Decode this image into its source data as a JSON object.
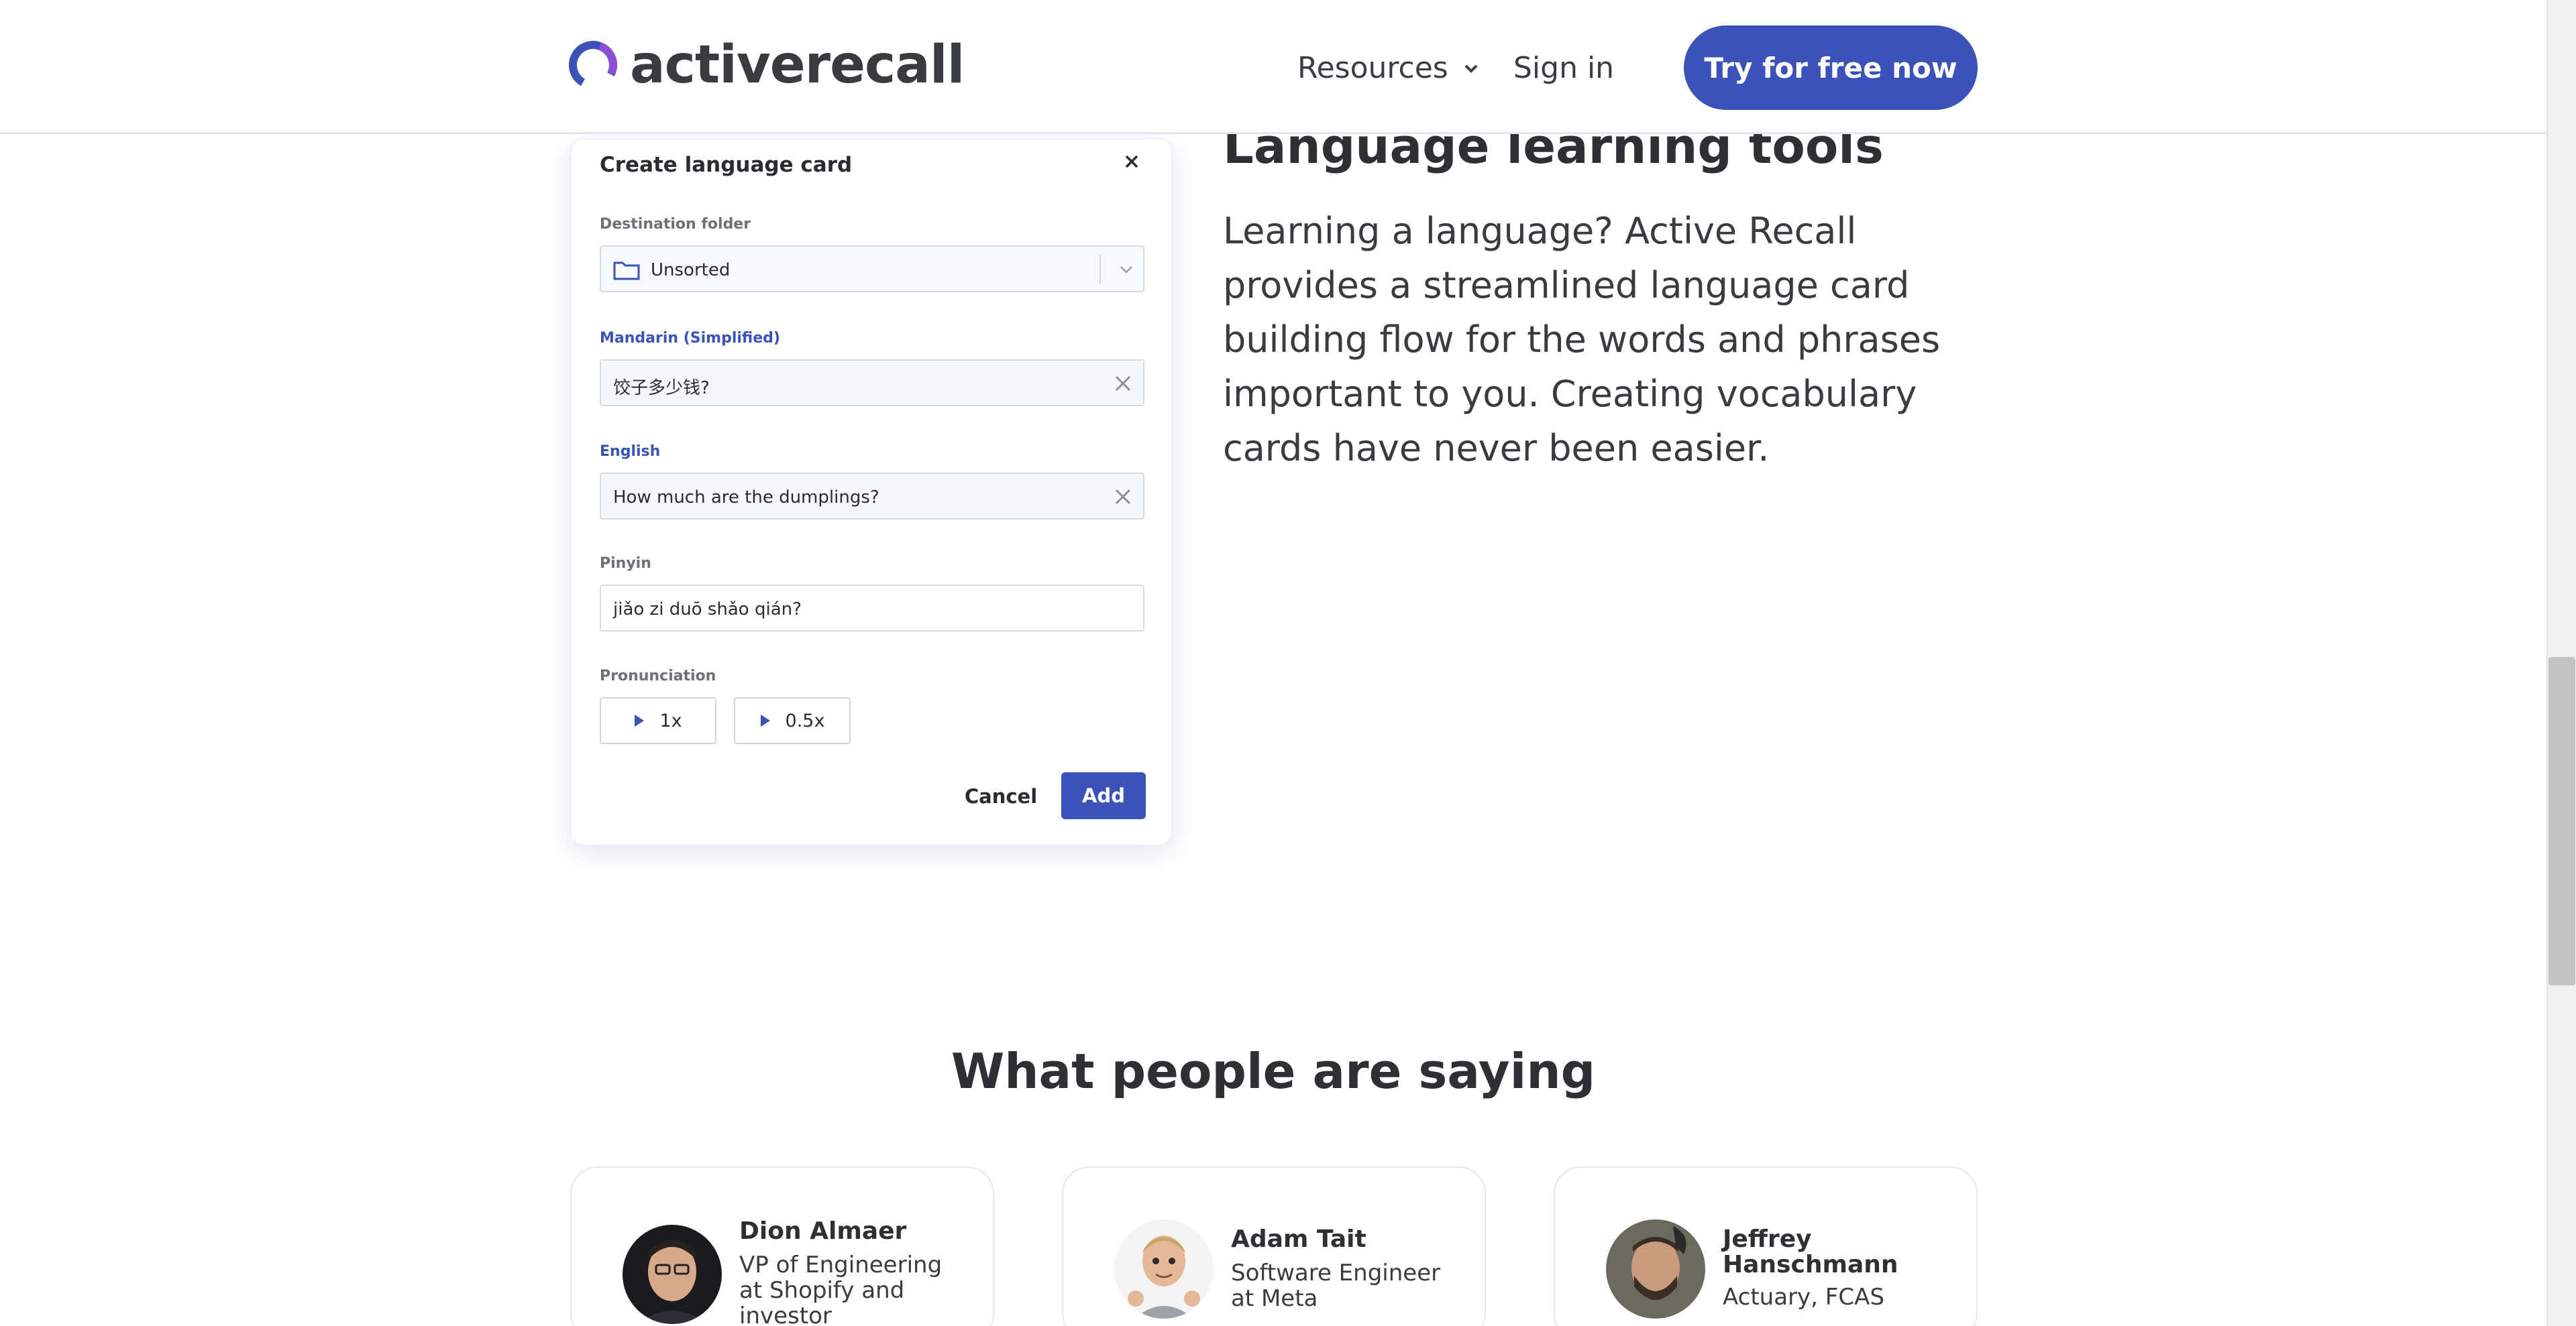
{
  "header": {
    "logo_text": "activerecall",
    "nav": {
      "resources_label": "Resources",
      "signin_label": "Sign in"
    },
    "cta_label": "Try for free now"
  },
  "card": {
    "title": "Create language card",
    "destination_label": "Destination folder",
    "destination_value": "Unsorted",
    "mandarin_label": "Mandarin (Simplified)",
    "mandarin_value": "饺子多少钱?",
    "english_label": "English",
    "english_value": "How much are the dumplings?",
    "pinyin_label": "Pinyin",
    "pinyin_value": "jiǎo zi duō shǎo qián?",
    "pronunciation_label": "Pronunciation",
    "pron_1x": "1x",
    "pron_05x": "0.5x",
    "cancel_label": "Cancel",
    "add_label": "Add"
  },
  "section": {
    "title": "Language learning tools",
    "body": "Learning a language? Active Recall provides a streamlined language card building flow for the words and phrases important to you. Creating vocabulary cards have never been easier."
  },
  "testimonials": {
    "heading": "What people are saying",
    "items": [
      {
        "name": "Dion Almaer",
        "role": "VP of Engineering at Shopify and investor"
      },
      {
        "name": "Adam Tait",
        "role": "Software Engineer at Meta"
      },
      {
        "name": "Jeffrey Hanschmann",
        "role": "Actuary, FCAS"
      }
    ]
  },
  "colors": {
    "brand": "#3b53b8",
    "logo_purple": "#8b4fd6",
    "text": "#333333"
  }
}
